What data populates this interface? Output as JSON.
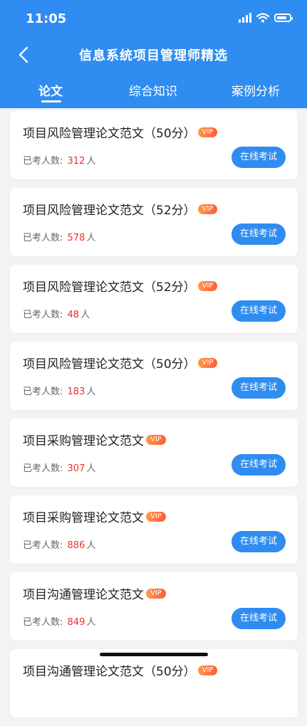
{
  "status_bar": {
    "time": "11:05"
  },
  "header": {
    "title": "信息系统项目管理师精选"
  },
  "tabs": [
    {
      "label": "论文",
      "active": true
    },
    {
      "label": "综合知识",
      "active": false
    },
    {
      "label": "案例分析",
      "active": false
    }
  ],
  "count_prefix": "已考人数:",
  "count_suffix": "人",
  "exam_label": "在线考试",
  "vip_label": "VIP",
  "cards": [
    {
      "title": "项目风险管理论文范文（50分）",
      "count": "312"
    },
    {
      "title": "项目风险管理论文范文（52分）",
      "count": "578"
    },
    {
      "title": "项目风险管理论文范文（52分）",
      "count": "48"
    },
    {
      "title": "项目风险管理论文范文（50分）",
      "count": "183"
    },
    {
      "title": "项目采购管理论文范文",
      "count": "307"
    },
    {
      "title": "项目采购管理论文范文",
      "count": "886"
    },
    {
      "title": "项目沟通管理论文范文",
      "count": "849"
    },
    {
      "title": "项目沟通管理论文范文（50分）",
      "count": ""
    }
  ],
  "colors": {
    "primary": "#2f8cf0",
    "count": "#e8312f",
    "vip": "#ff6a3d"
  }
}
